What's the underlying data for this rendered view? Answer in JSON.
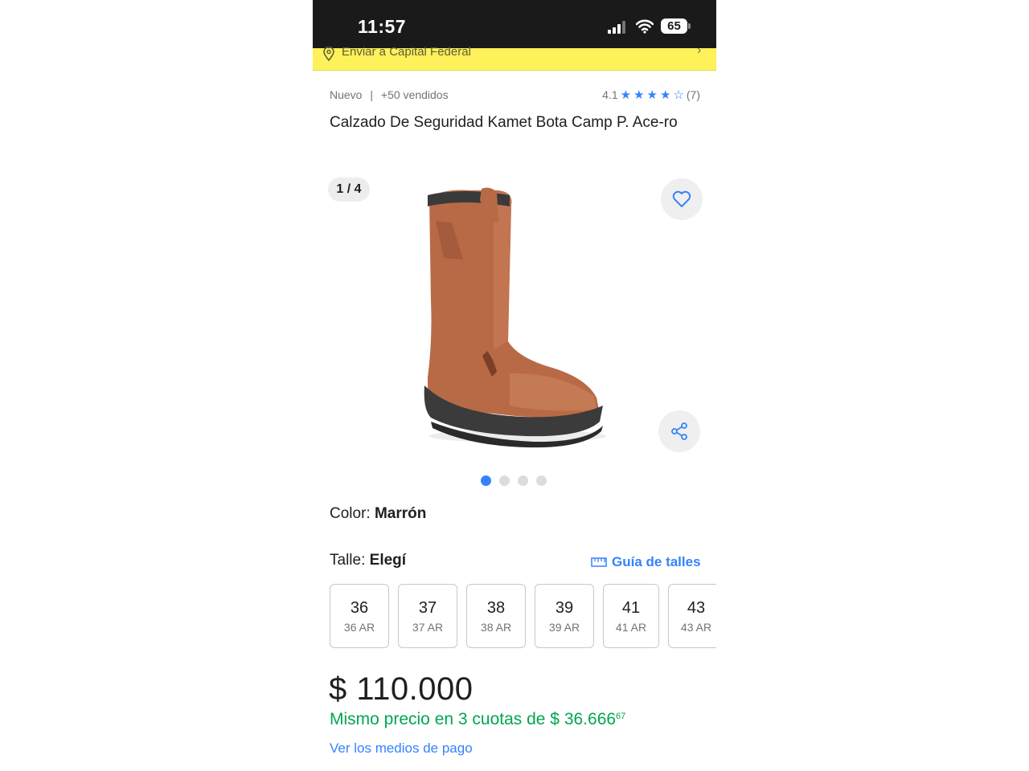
{
  "status_bar": {
    "time": "11:57",
    "battery": "65",
    "icons": [
      "cellular-signal-icon",
      "wifi-icon",
      "battery-icon"
    ]
  },
  "address_bar": {
    "text": "Enviar a Capital Federal",
    "icons": [
      "location-pin-icon",
      "chevron-right-icon"
    ],
    "background": "#fff159"
  },
  "product": {
    "condition": "Nuevo",
    "separator": "|",
    "sold": "+50 vendidos",
    "rating_value": "4.1",
    "rating_count": "(7)",
    "stars_filled": 4,
    "stars_total": 5,
    "title": "Calzado De Seguridad Kamet Bota Camp P. Ace-ro"
  },
  "gallery": {
    "counter": "1 / 4",
    "total_images": 4,
    "active_index": 0,
    "image_subject": "brown leather safety boot",
    "icons": [
      "heart-icon",
      "share-icon"
    ]
  },
  "variations": {
    "color_label": "Color:",
    "color_value": "Marrón",
    "size_label": "Talle:",
    "size_value": "Elegí",
    "size_guide": "Guía de talles",
    "sizes": [
      {
        "size": "36",
        "sub": "36 AR"
      },
      {
        "size": "37",
        "sub": "37 AR"
      },
      {
        "size": "38",
        "sub": "38 AR"
      },
      {
        "size": "39",
        "sub": "39 AR"
      },
      {
        "size": "41",
        "sub": "41 AR"
      },
      {
        "size": "43",
        "sub": "43 AR"
      }
    ]
  },
  "pricing": {
    "price": "$ 110.000",
    "installments_text": "Mismo precio en 3 cuotas de $ 36.666",
    "installments_cents": "67",
    "payment_link": "Ver los medios de pago",
    "accent_green": "#00a650",
    "accent_blue": "#3483fa"
  }
}
